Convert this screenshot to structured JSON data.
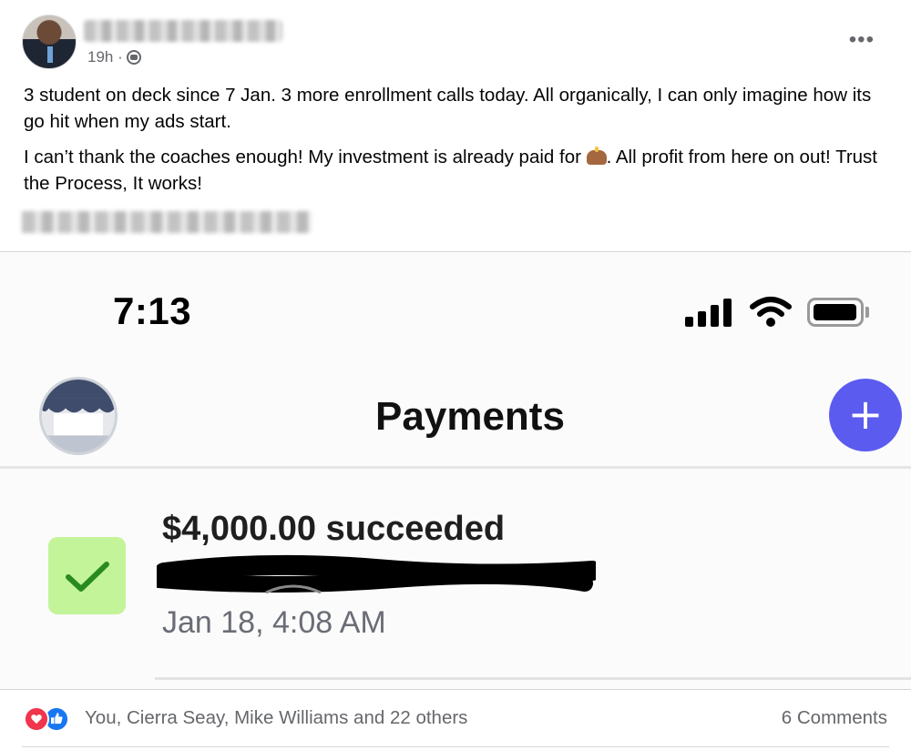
{
  "post": {
    "time": "19h ·",
    "audience_icon": "globe-icon",
    "more_icon": "more-options-icon",
    "paragraph_1": "3 student on deck since 7 Jan. 3 more enrollment calls today. All organically, I can only imagine how its go hit when my ads start.",
    "paragraph_2_before": "I can’t thank the coaches enough! My investment is already paid for ",
    "paragraph_2_after": ". All profit from here on out! Trust the Process, It works!"
  },
  "screenshot": {
    "status_time": "7:13",
    "title": "Payments",
    "add_label": "+",
    "payment": {
      "amount": "$4,000.00 succeeded",
      "date": "Jan 18, 4:08 AM",
      "status_color": "#c3f49a"
    },
    "accent_color": "#5b5bef"
  },
  "footer": {
    "reactions_text": "You, Cierra Seay, Mike Williams and 22 others",
    "comments_text": "6 Comments"
  }
}
